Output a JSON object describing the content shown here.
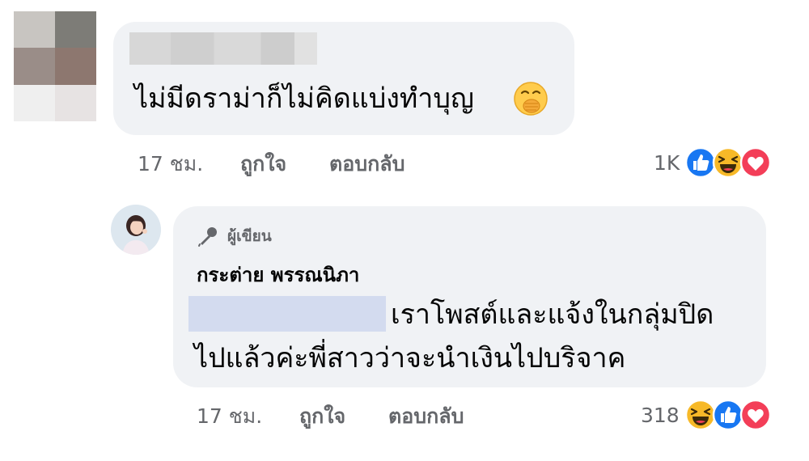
{
  "comment": {
    "author_name_redacted": true,
    "text": "ไม่มีดราม่าก็ไม่คิดแบ่งทำบุญ",
    "emoji": "face-with-hand-over-mouth-emoji",
    "meta": {
      "time": "17 ชม.",
      "like_label": "ถูกใจ",
      "reply_label": "ตอบกลับ"
    },
    "reactions": {
      "count": "1K",
      "icons": [
        "like-reaction-icon",
        "haha-reaction-icon",
        "love-reaction-icon"
      ]
    }
  },
  "reply": {
    "badge_label": "ผู้เขียน",
    "author_name": "กระต่าย พรรณนิภา",
    "mention_redacted": true,
    "text_line_1": "เราโพสต์และแจ้งในกลุ่มปิด",
    "text_line_2": "ไปแล้วค่ะพี่สาวว่าจะนำเงินไปบริจาค",
    "meta": {
      "time": "17 ชม.",
      "like_label": "ถูกใจ",
      "reply_label": "ตอบกลับ"
    },
    "reactions": {
      "count": "318",
      "icons": [
        "haha-reaction-icon",
        "like-reaction-icon",
        "love-reaction-icon"
      ]
    }
  },
  "colors": {
    "bubble_bg": "#f0f2f5",
    "meta_text": "#65676b",
    "like_blue": "#1877f2",
    "love_red": "#f33e58",
    "haha_yellow": "#f7b928"
  }
}
